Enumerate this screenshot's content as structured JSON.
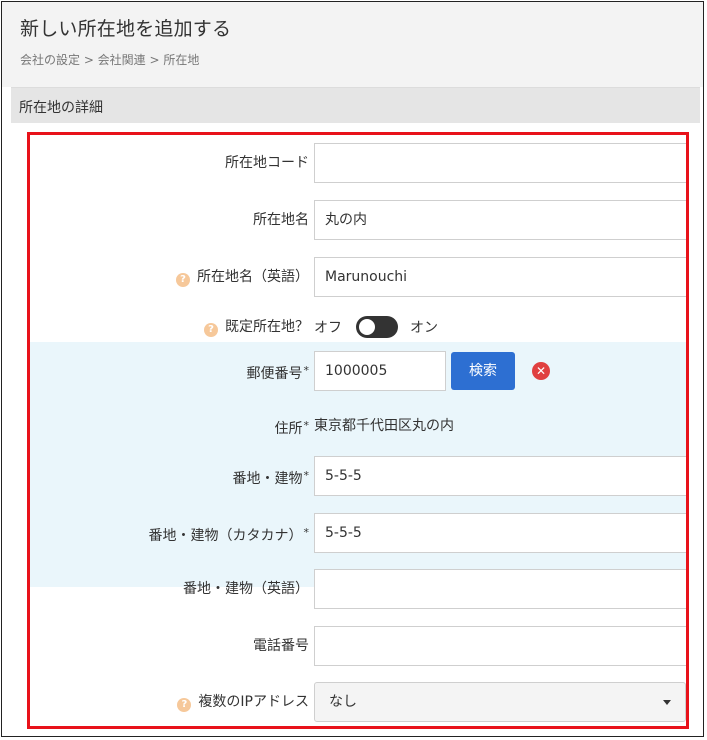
{
  "header": {
    "title": "新しい所在地を追加する",
    "breadcrumb": "会社の設定 > 会社関連 > 所在地"
  },
  "section": {
    "title": "所在地の詳細"
  },
  "form": {
    "location_code": {
      "label": "所在地コード",
      "value": ""
    },
    "location_name": {
      "label": "所在地名",
      "value": "丸の内"
    },
    "location_name_en": {
      "label": "所在地名（英語）",
      "value": "Marunouchi",
      "help_icon": "help-icon"
    },
    "default_location": {
      "label": "既定所在地？",
      "off_label": "オフ",
      "on_label": "オン",
      "state": "off",
      "help_icon": "help-icon"
    },
    "postal_code": {
      "label": "郵便番号",
      "required_mark": "*",
      "value": "1000005",
      "search_label": "検索"
    },
    "address": {
      "label": "住所",
      "required_mark": "*",
      "value": "東京都千代田区丸の内"
    },
    "street_building": {
      "label": "番地・建物",
      "required_mark": "*",
      "value": "5-5-5"
    },
    "street_building_kana": {
      "label": "番地・建物（カタカナ）",
      "required_mark": "*",
      "value": "5-5-5"
    },
    "street_building_en": {
      "label": "番地・建物（英語）",
      "value": ""
    },
    "phone": {
      "label": "電話番号",
      "value": ""
    },
    "multiple_ip": {
      "label": "複数のIPアドレス",
      "value": "なし",
      "help_icon": "help-icon"
    }
  },
  "colors": {
    "accent_button": "#2d6fd2",
    "highlight_border": "#e8121a",
    "address_band": "#eaf6fb",
    "help_icon": "#f6c89a",
    "clear_icon": "#e04040"
  }
}
